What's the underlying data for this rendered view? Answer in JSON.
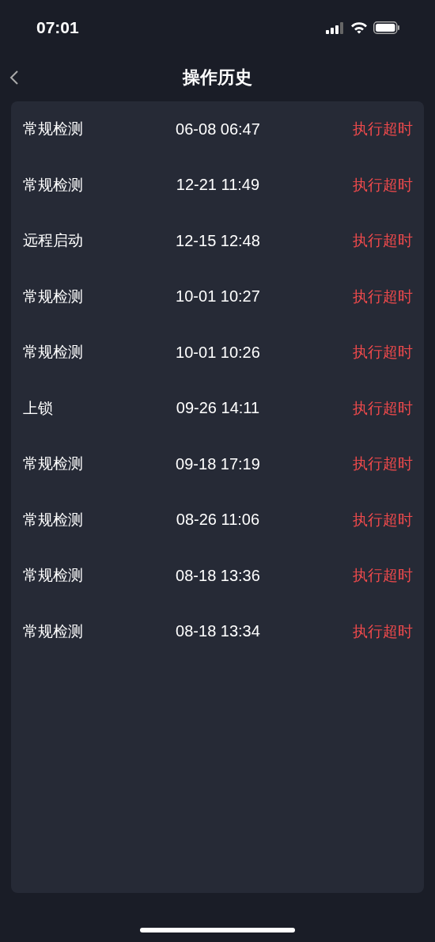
{
  "status_bar": {
    "time": "07:01"
  },
  "header": {
    "title": "操作历史"
  },
  "records": [
    {
      "operation": "常规检测",
      "time": "06-08 06:47",
      "result": "执行超时"
    },
    {
      "operation": "常规检测",
      "time": "12-21 11:49",
      "result": "执行超时"
    },
    {
      "operation": "远程启动",
      "time": "12-15 12:48",
      "result": "执行超时"
    },
    {
      "operation": "常规检测",
      "time": "10-01 10:27",
      "result": "执行超时"
    },
    {
      "operation": "常规检测",
      "time": "10-01 10:26",
      "result": "执行超时"
    },
    {
      "operation": "上锁",
      "time": "09-26 14:11",
      "result": "执行超时"
    },
    {
      "operation": "常规检测",
      "time": "09-18 17:19",
      "result": "执行超时"
    },
    {
      "operation": "常规检测",
      "time": "08-26 11:06",
      "result": "执行超时"
    },
    {
      "operation": "常规检测",
      "time": "08-18 13:36",
      "result": "执行超时"
    },
    {
      "operation": "常规检测",
      "time": "08-18 13:34",
      "result": "执行超时"
    }
  ]
}
